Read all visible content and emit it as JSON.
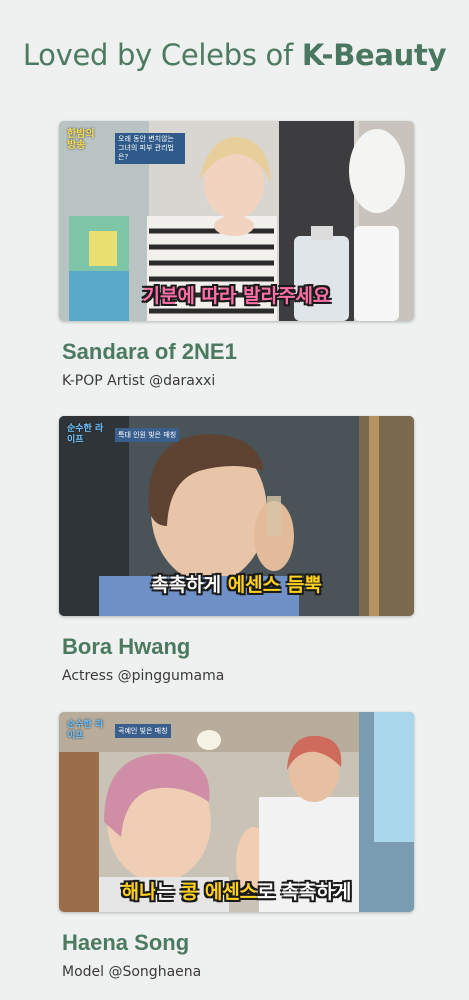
{
  "header": {
    "title_prefix": "Loved by Celebs of",
    "title_emphasis": "K-Beauty"
  },
  "celebs": [
    {
      "name": "Sandara of 2NE1",
      "handle": "K-POP Artist @daraxxi",
      "caption": "기분에 따라 발라주세요",
      "show_logo": "한밤의 방송",
      "overlay_text": "오래 동안 변치않는 그녀의 피부 관리법은?"
    },
    {
      "name": "Bora Hwang",
      "handle": "Actress @pinggumama",
      "caption_white": "촉촉하게 ",
      "caption_yellow": "에센스 듬뿍",
      "show_logo": "순수한 라이프",
      "overlay_text": "특대 인원 빛은 매칭"
    },
    {
      "name": "Haena Song",
      "handle": "Model @Songhaena",
      "caption_yellow_1": "해나",
      "caption_white_1": "는 ",
      "caption_yellow_2": "콩 에센스",
      "caption_white_2": "로 촉촉하게",
      "show_logo": "순수한 라이프",
      "overlay_text": "곡예인 빛은 매칭"
    }
  ],
  "colors": {
    "accent_green": "#4c7a60",
    "background": "#eef1ef",
    "caption_pink": "#ff6fa8",
    "caption_yellow": "#ffd21e"
  }
}
